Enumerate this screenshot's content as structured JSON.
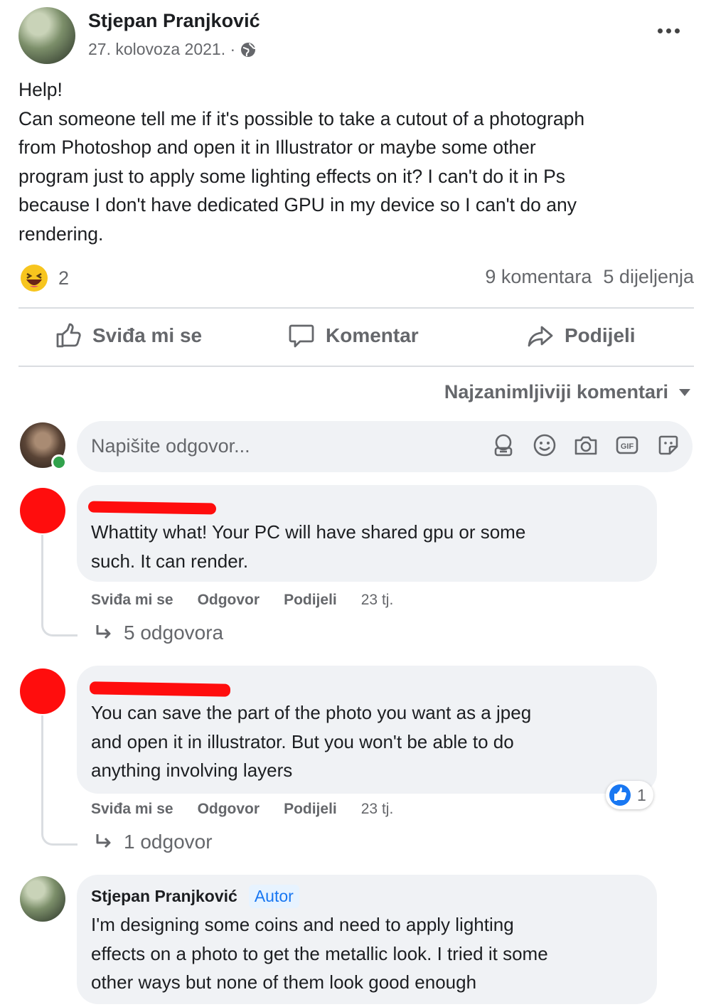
{
  "post": {
    "author": "Stjepan Pranjković",
    "date": "27. kolovoza 2021. ·",
    "more_icon": "more-horizontal-icon",
    "body_lines": [
      "Help!",
      "Can someone tell me if it's possible to take a cutout of a photograph",
      "from Photoshop and open it in Illustrator or maybe some other",
      "program just to apply some lighting effects on it? I can't do it in Ps",
      "because I don't have dedicated GPU in my device so I can't do any",
      "rendering."
    ],
    "reaction_count": "2",
    "comments_count": "9 komentara",
    "shares_count": "5 dijeljenja"
  },
  "actions": {
    "like": "Sviđa mi se",
    "comment": "Komentar",
    "share": "Podijeli"
  },
  "sort_label": "Najzanimljiviji komentari",
  "reply_input": {
    "placeholder": "Napišite odgovor..."
  },
  "comments": [
    {
      "lines": [
        "Whattity what! Your PC will have shared gpu or some",
        "such. It can render."
      ],
      "like": "Sviđa mi se",
      "reply": "Odgovor",
      "share": "Podijeli",
      "time": "23 tj.",
      "replies": "5 odgovora"
    },
    {
      "lines": [
        "You can save the part of the photo you want as a jpeg",
        "and open it in illustrator. But you won't be able to do",
        "anything involving layers"
      ],
      "like": "Sviđa mi se",
      "reply": "Odgovor",
      "share": "Podijeli",
      "time": "23 tj.",
      "reaction_count": "1",
      "replies": "1 odgovor"
    },
    {
      "author": "Stjepan Pranjković",
      "badge": "Autor",
      "lines": [
        "I'm designing some coins and need to apply lighting",
        "effects on a photo to get the metallic look. I tried it some",
        "other ways but none of them look good enough"
      ]
    }
  ],
  "colors": {
    "like_blue": "#1877f2",
    "redaction": "#ff0d0d",
    "badge_bg": "#e7f3ff",
    "badge_text": "#1877f2"
  }
}
